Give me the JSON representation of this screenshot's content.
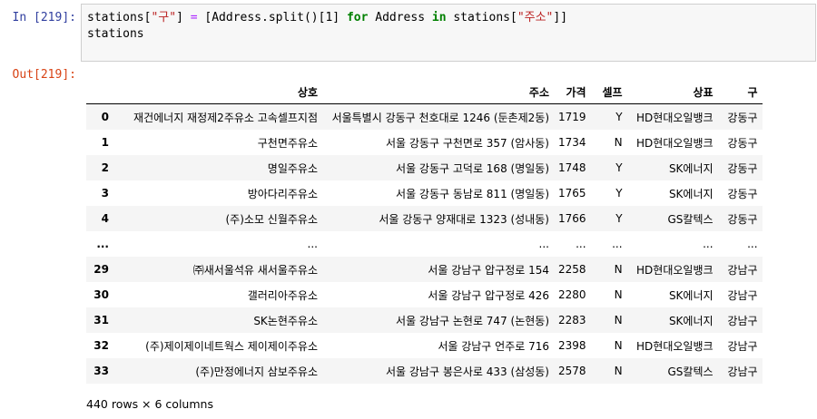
{
  "cell": {
    "in_prompt": "In [219]:",
    "out_prompt": "Out[219]:",
    "code": {
      "l1_a": "stations[",
      "l1_s1": "\"구\"",
      "l1_b": "] ",
      "l1_eq": "=",
      "l1_c": " [Address.split()[1] ",
      "l1_for": "for",
      "l1_d": " Address ",
      "l1_in": "in",
      "l1_e": " stations[",
      "l1_s2": "\"주소\"",
      "l1_f": "]]",
      "l2": "stations"
    }
  },
  "table": {
    "columns": [
      "",
      "상호",
      "주소",
      "가격",
      "셀프",
      "상표",
      "구"
    ],
    "rows": [
      [
        "0",
        "재건에너지 재정제2주유소 고속셀프지점",
        "서울특별시 강동구 천호대로 1246 (둔촌제2동)",
        "1719",
        "Y",
        "HD현대오일뱅크",
        "강동구"
      ],
      [
        "1",
        "구천면주유소",
        "서울 강동구 구천면로 357 (암사동)",
        "1734",
        "N",
        "HD현대오일뱅크",
        "강동구"
      ],
      [
        "2",
        "명일주유소",
        "서울 강동구 고덕로 168 (명일동)",
        "1748",
        "Y",
        "SK에너지",
        "강동구"
      ],
      [
        "3",
        "방아다리주유소",
        "서울 강동구 동남로 811 (명일동)",
        "1765",
        "Y",
        "SK에너지",
        "강동구"
      ],
      [
        "4",
        "(주)소모 신월주유소",
        "서울 강동구 양재대로 1323 (성내동)",
        "1766",
        "Y",
        "GS칼텍스",
        "강동구"
      ],
      [
        "...",
        "...",
        "...",
        "...",
        "...",
        "...",
        "..."
      ],
      [
        "29",
        "㈜새서울석유 새서울주유소",
        "서울 강남구 압구정로 154",
        "2258",
        "N",
        "HD현대오일뱅크",
        "강남구"
      ],
      [
        "30",
        "갤러리아주유소",
        "서울 강남구 압구정로 426",
        "2280",
        "N",
        "SK에너지",
        "강남구"
      ],
      [
        "31",
        "SK논현주유소",
        "서울 강남구 논현로 747 (논현동)",
        "2283",
        "N",
        "SK에너지",
        "강남구"
      ],
      [
        "32",
        "(주)제이제이네트웍스 제이제이주유소",
        "서울 강남구 언주로 716",
        "2398",
        "N",
        "HD현대오일뱅크",
        "강남구"
      ],
      [
        "33",
        "(주)만정에너지 삼보주유소",
        "서울 강남구 봉은사로 433 (삼성동)",
        "2578",
        "N",
        "GS칼텍스",
        "강남구"
      ]
    ],
    "shape_text": "440 rows × 6 columns"
  }
}
